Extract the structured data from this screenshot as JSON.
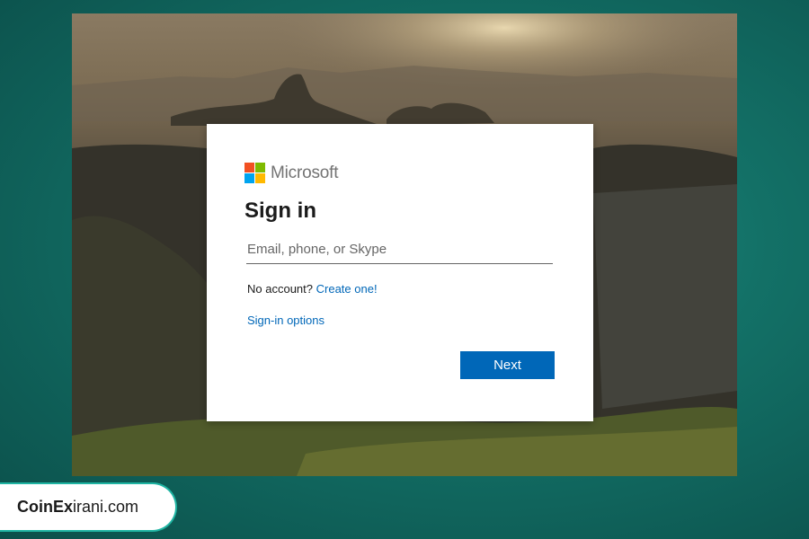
{
  "brand": {
    "name": "Microsoft",
    "logo_colors": [
      "#f25022",
      "#7fba00",
      "#00a4ef",
      "#ffb900"
    ]
  },
  "signin": {
    "title": "Sign in",
    "email_placeholder": "Email, phone, or Skype",
    "email_value": "",
    "no_account_text": "No account?",
    "create_link": "Create one!",
    "options_link": "Sign-in options",
    "next_label": "Next"
  },
  "watermark": {
    "bold_part": "CoinEx",
    "rest": "irani.com"
  },
  "colors": {
    "accent": "#0067b8",
    "backdrop": "#137167"
  }
}
